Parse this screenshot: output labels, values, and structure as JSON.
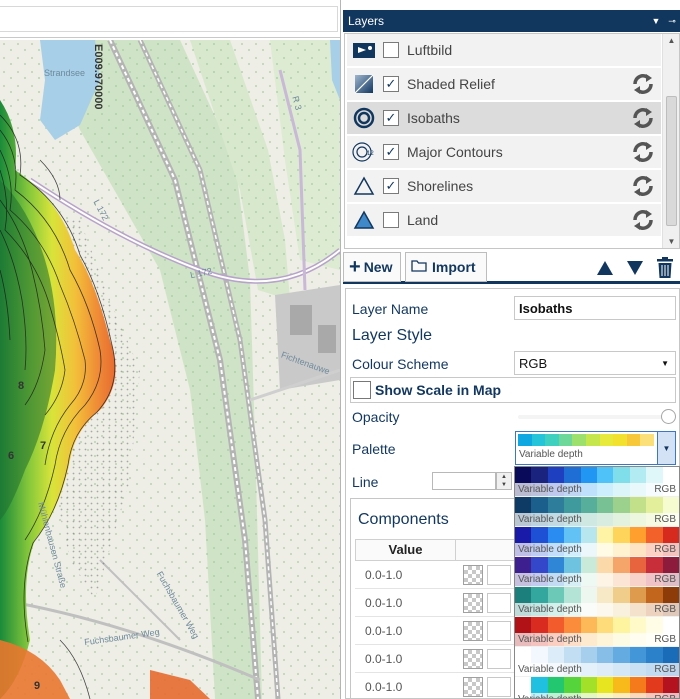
{
  "map": {
    "labels": {
      "strandsee": "Strandsee",
      "easting": "E009.970000",
      "l172_a": "L 172",
      "l172_b": "L 172",
      "r3": "R 3",
      "fichtenau": "Fichtenauwe",
      "fuchsbaumer_a": "Fuchsbaumer Weg",
      "fuchsbaumer_b": "Fuchsbaumer Weg",
      "mulhausen": "Mühlenhausen Straße",
      "d1": "9",
      "d2": "8",
      "d3": "7",
      "d4": "6"
    }
  },
  "layers_panel": {
    "title": "Layers",
    "pin_icon": "pin-icon",
    "dropdown_icon": "dropdown-arrow-icon",
    "items": [
      {
        "name": "Luftbild",
        "checked": false,
        "icon": "aerial-image-icon"
      },
      {
        "name": "Shaded Relief",
        "checked": true,
        "icon": "shaded-relief-icon"
      },
      {
        "name": "Isobaths",
        "checked": true,
        "icon": "isobaths-icon",
        "selected": true
      },
      {
        "name": "Major Contours",
        "checked": true,
        "icon": "major-contours-icon"
      },
      {
        "name": "Shorelines",
        "checked": true,
        "icon": "shorelines-icon"
      },
      {
        "name": "Land",
        "checked": false,
        "icon": "land-icon"
      }
    ],
    "check_mark": "✓"
  },
  "toolbar": {
    "new_label": "New",
    "import_label": "Import"
  },
  "properties": {
    "layer_name_label": "Layer Name",
    "layer_name_value": "Isobaths",
    "layer_style_heading": "Layer Style",
    "colour_scheme_label": "Colour Scheme",
    "colour_scheme_value": "RGB",
    "show_scale_label": "Show Scale in Map",
    "opacity_label": "Opacity",
    "opacity_value": 1.0,
    "palette_label": "Palette",
    "palette_selected_caption": "Variable depth",
    "line_label": "Line",
    "components_heading": "Components",
    "components_column": "Value",
    "component_rows": [
      "0.0-1.0",
      "0.0-1.0",
      "0.0-1.0",
      "0.0-1.0",
      "0.0-1.0"
    ]
  },
  "palette_list": {
    "items": [
      {
        "caption": "Variable depth",
        "mode": "RGB",
        "colors": [
          "#0a0a5a",
          "#1a237e",
          "#1e3fbf",
          "#1f6ed6",
          "#2196f3",
          "#4fc3f7",
          "#80deea",
          "#b2ebf2",
          "#e0f7fa",
          "#ffffff"
        ]
      },
      {
        "caption": "Variable depth",
        "mode": "RGB",
        "colors": [
          "#0d3b66",
          "#1b5f8c",
          "#2e7d9a",
          "#3f9a9e",
          "#56ae9b",
          "#77c194",
          "#9bd18d",
          "#c2e08a",
          "#e3ef9a",
          "#f7fbd0"
        ]
      },
      {
        "caption": "Variable depth",
        "mode": "RGB",
        "colors": [
          "#1a1aa8",
          "#1e50d6",
          "#2a8bf0",
          "#62c2f5",
          "#b8e6ef",
          "#fff3a6",
          "#ffd45a",
          "#ff9f2e",
          "#f2612a",
          "#d62a1e"
        ]
      },
      {
        "caption": "Variable depth",
        "mode": "RGB",
        "colors": [
          "#3d1f8f",
          "#3446c9",
          "#2f86d6",
          "#6ec3e0",
          "#c9ead9",
          "#fbd9a9",
          "#f5a56a",
          "#e8643f",
          "#c82d3a",
          "#8d1c3c"
        ]
      },
      {
        "caption": "Variable depth",
        "mode": "RGB",
        "colors": [
          "#1c7f7c",
          "#33a79e",
          "#6cc9b7",
          "#b4e4d6",
          "#eef7ef",
          "#f7e9c6",
          "#f0cd8b",
          "#de9a4d",
          "#c2661d",
          "#8e3b0a"
        ]
      },
      {
        "caption": "Variable depth",
        "mode": "RGB",
        "colors": [
          "#b01217",
          "#d92b20",
          "#f25b2b",
          "#fb8c3c",
          "#fdb857",
          "#fedc7a",
          "#fef4a0",
          "#fffac8",
          "#fffde6",
          "#ffffff"
        ]
      },
      {
        "caption": "Variable depth",
        "mode": "RGB",
        "colors": [
          "#ffffff",
          "#f2f8fd",
          "#dcecf8",
          "#c2def3",
          "#a6cfee",
          "#87bee8",
          "#64abe1",
          "#4397d8",
          "#2b82cb",
          "#1b6cb8"
        ]
      },
      {
        "caption": "Variable depth",
        "mode": "RGB",
        "colors": [
          "#ffffff",
          "#20c0e0",
          "#23c76f",
          "#55d43b",
          "#a2e02a",
          "#e6e51f",
          "#f8b91b",
          "#f47a1b",
          "#e23a1c",
          "#b51220"
        ]
      }
    ]
  },
  "palette_selected_colors": [
    "#0fa8e0",
    "#25c4d8",
    "#3fd0c0",
    "#6dd89a",
    "#9de06d",
    "#c6e64d",
    "#e7ea3b",
    "#f2e12f",
    "#f7c93a",
    "#fbe07a"
  ],
  "colors": {
    "header_bg": "#12375f",
    "accent": "#12375f",
    "selection_border": "#3c78c2"
  }
}
